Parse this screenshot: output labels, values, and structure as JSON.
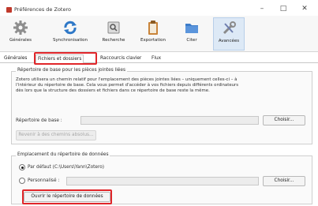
{
  "window": {
    "title": "Préférences de Zotero",
    "minimize": "–",
    "maximize": "□",
    "close": "✕"
  },
  "toolbar": {
    "items": [
      {
        "label": "Générales",
        "icon": "gear-icon"
      },
      {
        "label": "Synchronisation",
        "icon": "sync-icon"
      },
      {
        "label": "Recherche",
        "icon": "search-icon"
      },
      {
        "label": "Exportation",
        "icon": "clipboard-icon"
      },
      {
        "label": "Citer",
        "icon": "folder-icon"
      },
      {
        "label": "Avancées",
        "icon": "wrench-icon",
        "selected": true
      }
    ]
  },
  "tabs": [
    {
      "label": "Générales"
    },
    {
      "label": "Fichiers et dossiers",
      "active": true
    },
    {
      "label": "Raccourcis clavier"
    },
    {
      "label": "Flux"
    }
  ],
  "base_directory": {
    "title": "Répertoire de base pour les pièces jointes liées",
    "description_lines": [
      "Zotero utilisera un chemin relatif pour l'emplacement des pièces jointes liées – uniquement celles-ci – à",
      "l'intérieur du répertoire de base. Cela vous permet d'accéder à vos fichiers depuis différents ordinateurs",
      "dès lors que la structure des dossiers et fichiers dans ce répertoire de base reste la même."
    ],
    "field_label": "Répertoire de base :",
    "field_value": "",
    "choose_button": "Choisir...",
    "revert_button": "Revenir à des chemins absolus..."
  },
  "data_directory": {
    "title": "Emplacement du répertoire de données",
    "default_option": "Par défaut (C:\\Users\\Yann\\Zotero)",
    "custom_option": "Personnalisé :",
    "custom_value": "",
    "choose_button": "Choisir...",
    "open_button": "Ouvrir le répertoire de données"
  },
  "colors": {
    "highlight": "#e0262a",
    "selected_tool": "#dde9f6"
  }
}
